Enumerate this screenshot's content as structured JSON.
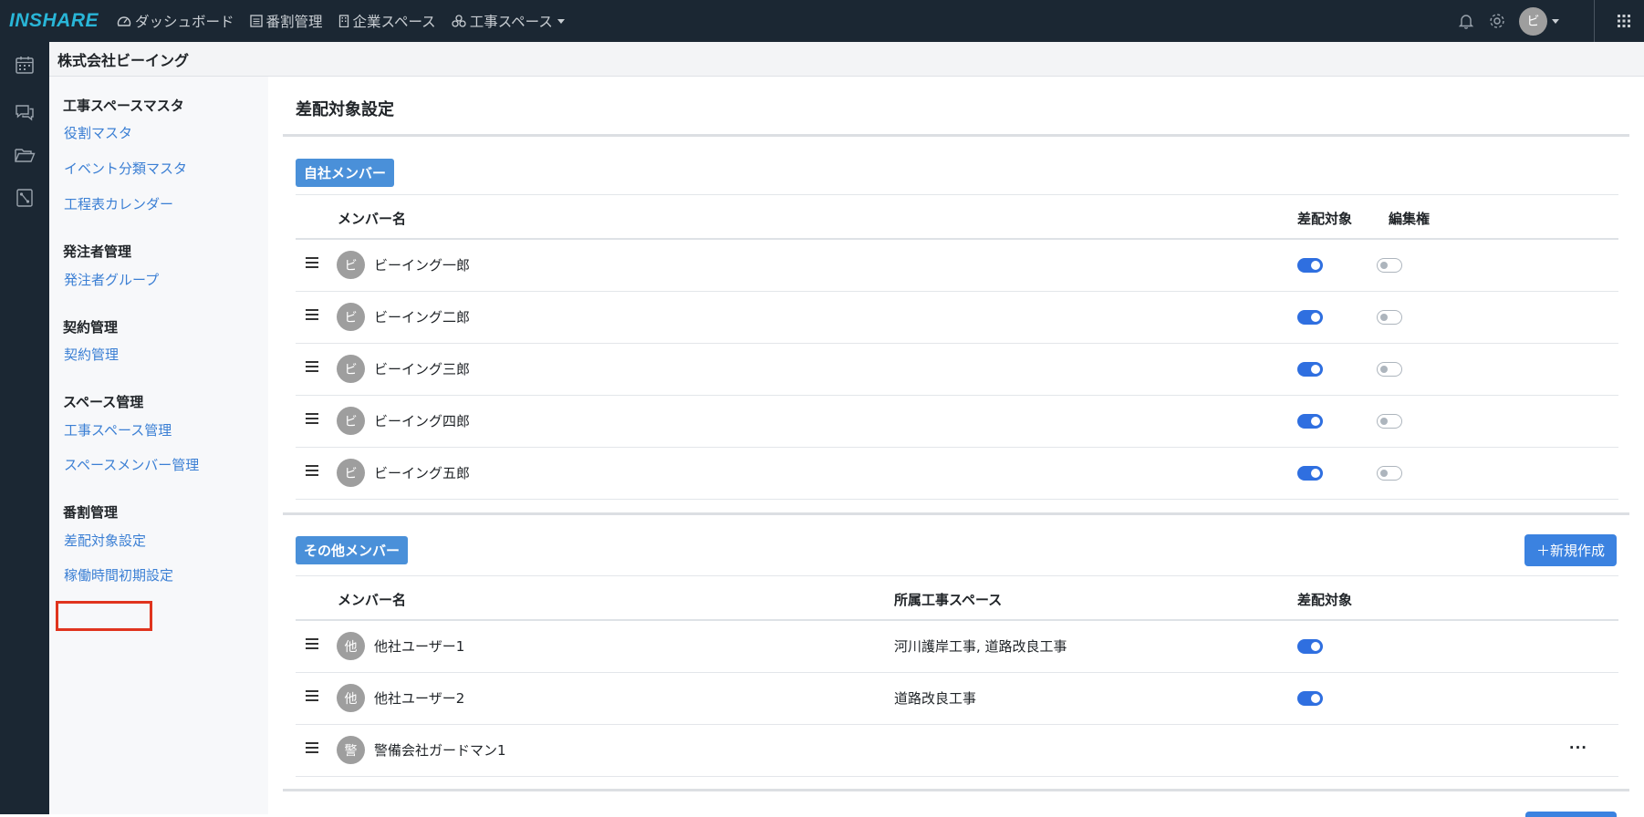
{
  "app": {
    "logo": "INSHARE"
  },
  "topnav": [
    {
      "label": "ダッシュボード",
      "icon": "dashboard-icon"
    },
    {
      "label": "番割管理",
      "icon": "list-icon"
    },
    {
      "label": "企業スペース",
      "icon": "building-icon"
    },
    {
      "label": "工事スペース",
      "icon": "cubes-icon"
    }
  ],
  "topright": {
    "avatar": "ビ"
  },
  "company": "株式会社ビーイング",
  "sidebar": {
    "sections": [
      {
        "title": "工事スペースマスタ",
        "items": [
          "役割マスタ",
          "イベント分類マスタ",
          "工程表カレンダー"
        ]
      },
      {
        "title": "発注者管理",
        "items": [
          "発注者グループ"
        ]
      },
      {
        "title": "契約管理",
        "items": [
          "契約管理"
        ]
      },
      {
        "title": "スペース管理",
        "items": [
          "工事スペース管理",
          "スペースメンバー管理"
        ]
      },
      {
        "title": "番割管理",
        "items": [
          "差配対象設定",
          "稼働時間初期設定"
        ]
      }
    ],
    "active": "差配対象設定"
  },
  "main": {
    "title": "差配対象設定",
    "own": {
      "chip": "自社メンバー",
      "headers": {
        "name": "メンバー名",
        "target": "差配対象",
        "edit": "編集権"
      },
      "rows": [
        {
          "avatar": "ビ",
          "name": "ビーイング一郎",
          "target": true,
          "edit": false
        },
        {
          "avatar": "ビ",
          "name": "ビーイング二郎",
          "target": true,
          "edit": false
        },
        {
          "avatar": "ビ",
          "name": "ビーイング三郎",
          "target": true,
          "edit": false
        },
        {
          "avatar": "ビ",
          "name": "ビーイング四郎",
          "target": true,
          "edit": false
        },
        {
          "avatar": "ビ",
          "name": "ビーイング五郎",
          "target": true,
          "edit": false
        }
      ]
    },
    "other": {
      "chip": "その他メンバー",
      "new_button": "＋新規作成",
      "headers": {
        "name": "メンバー名",
        "space": "所属工事スペース",
        "target": "差配対象"
      },
      "rows": [
        {
          "avatar": "他",
          "name": "他社ユーザー1",
          "space": "河川護岸工事, 道路改良工事",
          "target": true
        },
        {
          "avatar": "他",
          "name": "他社ユーザー2",
          "space": "道路改良工事",
          "target": true
        },
        {
          "avatar": "警",
          "name": "警備会社ガードマン1",
          "space": "",
          "target": null,
          "more": "···"
        }
      ]
    }
  }
}
